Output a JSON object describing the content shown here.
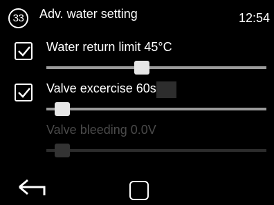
{
  "header": {
    "menu_number": "33",
    "title": "Adv. water setting",
    "time": "12:54"
  },
  "settings": [
    {
      "label": "Water return limit 45°C",
      "checked": true,
      "enabled": true,
      "slider_value": 0.43
    },
    {
      "label": "Valve excercise 60s",
      "checked": true,
      "enabled": true,
      "slider_value": 0.04
    },
    {
      "label": "Valve bleeding 0.0V",
      "checked": false,
      "enabled": false,
      "slider_value": 0.04
    }
  ],
  "footer": {
    "back_icon": "back-arrow-icon",
    "home_icon": "home-square-icon"
  }
}
